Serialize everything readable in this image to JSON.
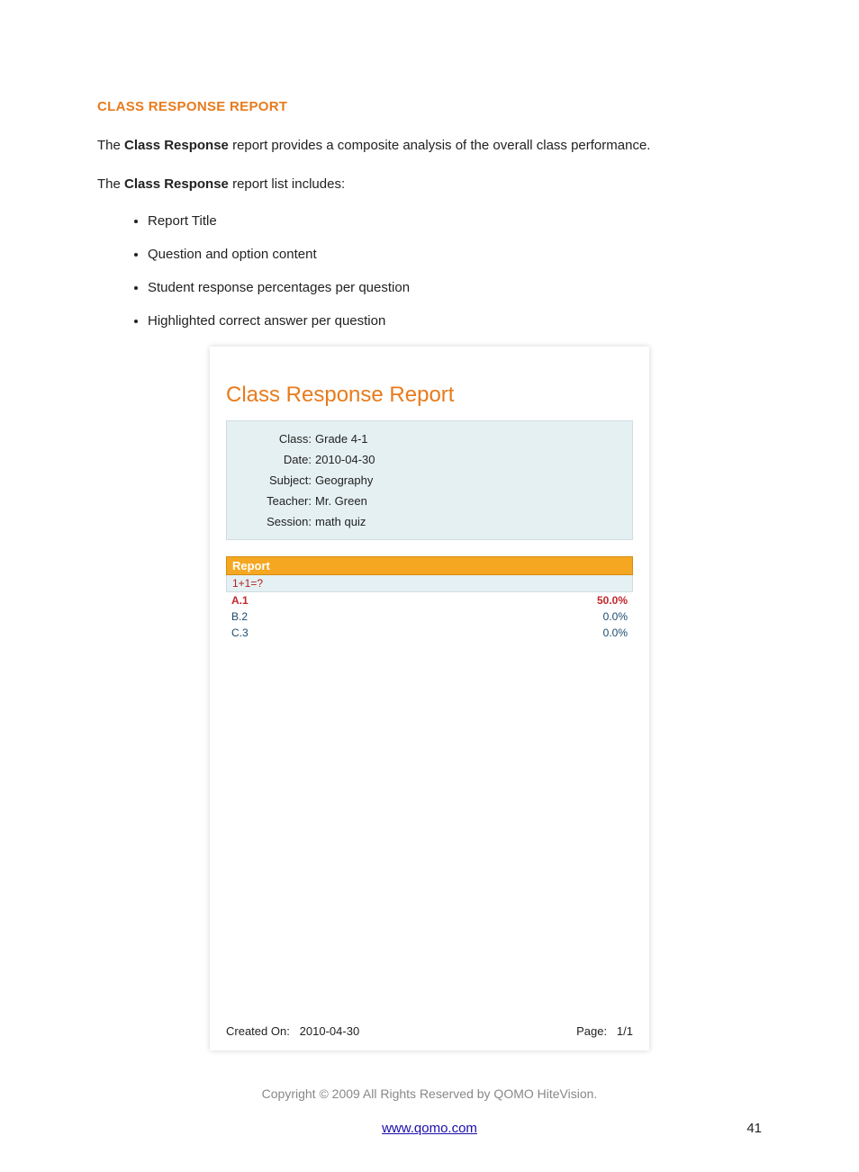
{
  "heading": "CLASS RESPONSE REPORT",
  "para1_pre": "The ",
  "para1_bold": "Class Response",
  "para1_post": " report provides a composite analysis of the overall class performance.",
  "para2_pre": "The ",
  "para2_bold": "Class Response",
  "para2_post": " report list includes:",
  "bullets": [
    "Report Title",
    "Question and option content",
    "Student response percentages per question",
    "Highlighted correct answer per question"
  ],
  "report": {
    "title": "Class Response Report",
    "info": {
      "class_label": "Class:",
      "class_value": "Grade 4-1",
      "date_label": "Date:",
      "date_value": "2010-04-30",
      "subject_label": "Subject:",
      "subject_value": "Geography",
      "teacher_label": "Teacher:",
      "teacher_value": "Mr. Green",
      "session_label": "Session:",
      "session_value": "math quiz"
    },
    "header_bar": "Report",
    "question": "1+1=?",
    "options": [
      {
        "label": "A.1",
        "pct": "50.0%",
        "correct": true
      },
      {
        "label": "B.2",
        "pct": "0.0%",
        "correct": false
      },
      {
        "label": "C.3",
        "pct": "0.0%",
        "correct": false
      }
    ],
    "created_label": "Created On:",
    "created_value": "2010-04-30",
    "page_label": "Page:",
    "page_value": "1/1"
  },
  "copyright": "Copyright © 2009 All Rights Reserved by QOMO HiteVision.",
  "footer_link": "www.qomo.com",
  "footer_page": "41"
}
